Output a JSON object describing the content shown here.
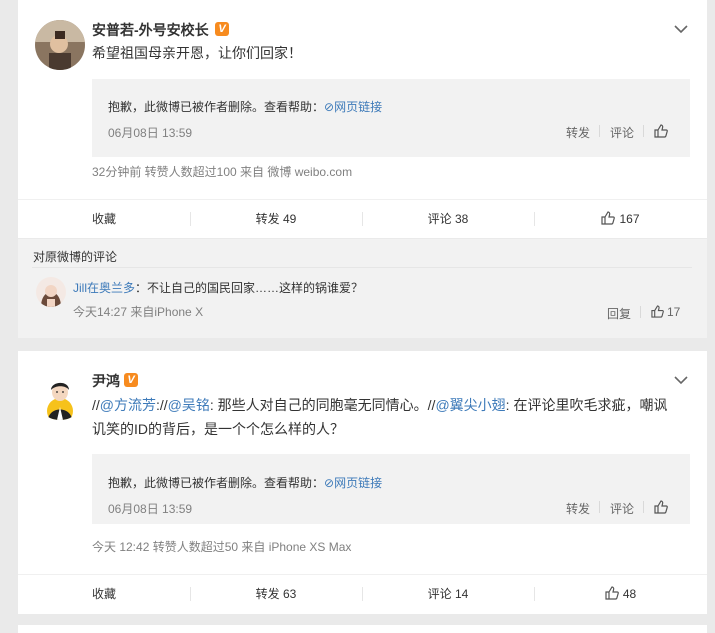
{
  "post1": {
    "username": "安普若-外号安校长",
    "verified": "V",
    "text": "希望祖国母亲开恩，让你们回家！",
    "repost": {
      "deleted_text": "抱歉，此微博已被作者删除。查看帮助：",
      "link_text": "网页链接",
      "date": "06月08日 13:59",
      "forward": "转发",
      "comment": "评论"
    },
    "meta": "32分钟前 转赞人数超过100 来自 微博 weibo.com",
    "actions": {
      "favorite": "收藏",
      "forward": "转发 49",
      "comment": "评论 38",
      "like": "167"
    }
  },
  "comment_box": {
    "header": "对原微博的评论",
    "user": "Jill在奥兰多",
    "text": "：不让自己的国民回家……这样的锅谁爱？",
    "time": "今天14:27 来自iPhone X",
    "reply": "回复",
    "likes": "17"
  },
  "post2": {
    "username": "尹鸿",
    "verified": "V",
    "text_parts": {
      "p1": "//",
      "m1": "@方流芳",
      "p2": ":",
      "p3": "//",
      "m2": "@吴铭",
      "p4": ": 那些人对自己的同胞毫无同情心。",
      "p5": "//",
      "m3": "@翼尖小翅",
      "p6": ": 在评论里吹毛求疵，嘲讽",
      "line2": "讥笑的ID的背后，是一个个怎么样的人？"
    },
    "repost": {
      "deleted_text": "抱歉，此微博已被作者删除。查看帮助：",
      "link_text": "网页链接",
      "date": "06月08日 13:59",
      "forward": "转发",
      "comment": "评论"
    },
    "meta": "今天 12:42 转赞人数超过50 来自 iPhone XS Max",
    "actions": {
      "favorite": "收藏",
      "forward": "转发 63",
      "comment": "评论 14",
      "like": "48"
    }
  }
}
